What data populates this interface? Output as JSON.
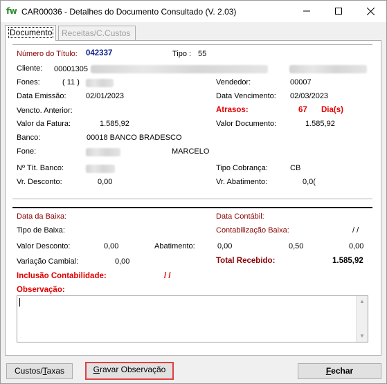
{
  "window": {
    "app_logo": "fw",
    "title": "CAR00036 - Detalhes do Documento Consultado  (V. 2.03)"
  },
  "tabs": [
    {
      "label": "Documento"
    },
    {
      "label": "Receitas/C.Custos"
    }
  ],
  "doc": {
    "numero_titulo_label": "Número do Título:",
    "numero_titulo": "042337",
    "tipo_label": "Tipo :",
    "tipo": "55",
    "cliente_label": "Cliente:",
    "cliente_codigo": "00001305",
    "fones_label": "Fones:",
    "fones_ddd": "( 11 )",
    "vendedor_label": "Vendedor:",
    "vendedor": "00007",
    "data_emissao_label": "Data Emissão:",
    "data_emissao": "02/01/2023",
    "data_vencimento_label": "Data Vencimento:",
    "data_vencimento": "02/03/2023",
    "vencto_anterior_label": "Vencto. Anterior:",
    "atrasos_label": "Atrasos:",
    "atrasos": "67",
    "atrasos_unit": "Dia(s)",
    "valor_fatura_label": "Valor da Fatura:",
    "valor_fatura": "1.585,92",
    "valor_documento_label": "Valor Documento:",
    "valor_documento": "1.585,92",
    "banco_label": "Banco:",
    "banco": "00018 BANCO BRADESCO",
    "fone_label": "Fone:",
    "contato": "MARCELO",
    "nro_tit_banco_label": "Nº Tít. Banco:",
    "tipo_cobranca_label": "Tipo Cobrança:",
    "tipo_cobranca": "CB",
    "vr_desconto_label": "Vr. Desconto:",
    "vr_desconto": "0,00",
    "vr_abatimento_label": "Vr. Abatimento:",
    "vr_abatimento": "0,0("
  },
  "baixa": {
    "data_baixa_label": "Data da Baixa:",
    "data_contabil_label": "Data Contábil:",
    "tipo_baixa_label": "Tipo de Baixa:",
    "contabilizacao_label": "Contabilização Baixa:",
    "contabilizacao": "/ /",
    "valor_desconto_label": "Valor Desconto:",
    "valor_desconto": "0,00",
    "abatimento_label": "Abatimento:",
    "abatimento": "0,00",
    "abat_val2": "0,50",
    "abat_val3": "0,00",
    "variacao_label": "Variação Cambial:",
    "variacao": "0,00",
    "total_recebido_label": "Total Recebido:",
    "total_recebido": "1.585,92",
    "inclusao_label": "Inclusão Contabilidade:",
    "inclusao": "/ /",
    "observacao_label": "Observação:",
    "observacao_value": ""
  },
  "buttons": {
    "custos_prefix": "Custos/",
    "custos_underlined": "T",
    "custos_suffix": "axas",
    "gravar_underlined": "G",
    "gravar_suffix": "ravar Observação",
    "fechar_underlined": "F",
    "fechar_suffix": "echar"
  },
  "colors": {
    "label_dark_red": "#8b0000",
    "alert_red": "#e00000",
    "title_blue": "#0b1f88",
    "highlight_border": "#e04040"
  }
}
